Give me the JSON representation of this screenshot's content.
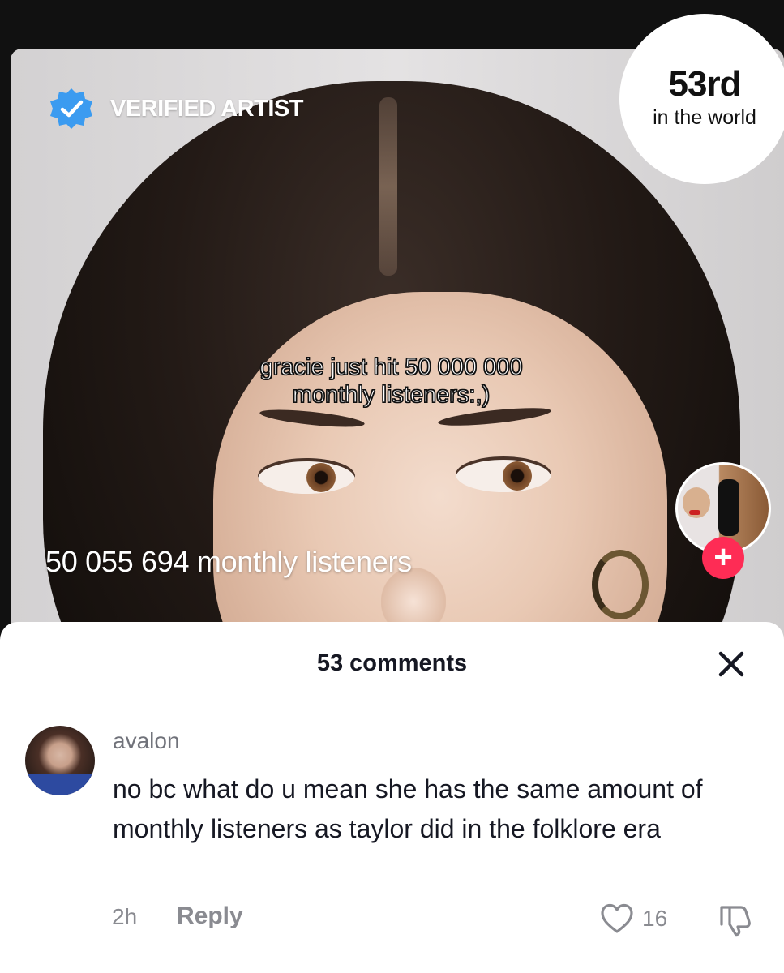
{
  "video": {
    "verified_label": "VERIFIED ARTIST",
    "rank": {
      "value": "53rd",
      "subtitle": "in the world"
    },
    "caption_line1": "gracie just hit 50 000 000",
    "caption_line2": "monthly listeners:,)",
    "listeners": "50 055 694 monthly listeners",
    "follow_icon": "+"
  },
  "comments": {
    "title": "53 comments",
    "items": [
      {
        "username": "avalon",
        "text": "no bc what do u mean she has the same amount of monthly listeners as taylor did in the folklore era",
        "time": "2h",
        "reply_label": "Reply",
        "likes": "16"
      }
    ]
  },
  "colors": {
    "accent_red": "#fe2c55",
    "verified_blue": "#3b9bf0",
    "text_primary": "#161823",
    "text_secondary": "#8a8b91"
  },
  "icons": {
    "verified": "verified-badge-icon",
    "close": "close-icon",
    "like": "heart-icon",
    "dislike": "thumbs-down-icon",
    "follow": "plus-icon"
  }
}
